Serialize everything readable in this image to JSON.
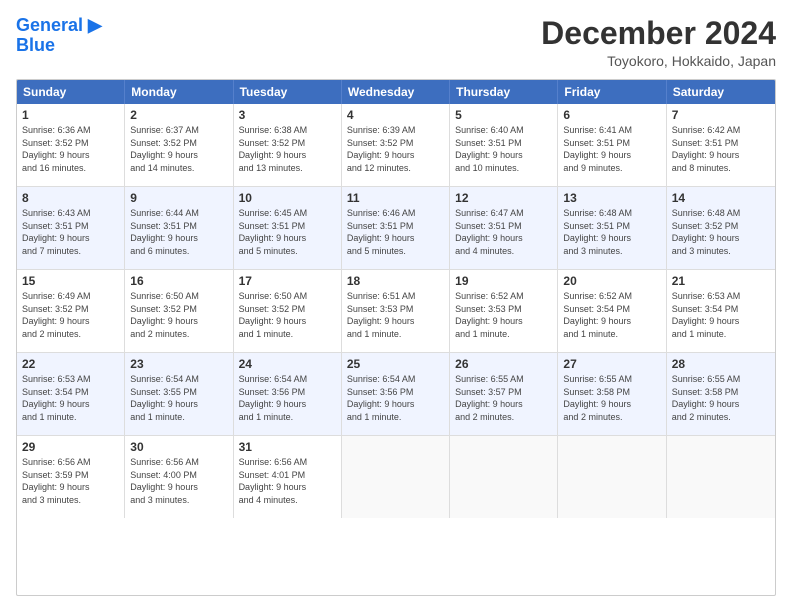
{
  "header": {
    "logo_line1": "General",
    "logo_line2": "Blue",
    "title": "December 2024",
    "subtitle": "Toyokoro, Hokkaido, Japan"
  },
  "calendar": {
    "days_of_week": [
      "Sunday",
      "Monday",
      "Tuesday",
      "Wednesday",
      "Thursday",
      "Friday",
      "Saturday"
    ],
    "rows": [
      {
        "alt": false,
        "cells": [
          {
            "day": "1",
            "info": "Sunrise: 6:36 AM\nSunset: 3:52 PM\nDaylight: 9 hours\nand 16 minutes."
          },
          {
            "day": "2",
            "info": "Sunrise: 6:37 AM\nSunset: 3:52 PM\nDaylight: 9 hours\nand 14 minutes."
          },
          {
            "day": "3",
            "info": "Sunrise: 6:38 AM\nSunset: 3:52 PM\nDaylight: 9 hours\nand 13 minutes."
          },
          {
            "day": "4",
            "info": "Sunrise: 6:39 AM\nSunset: 3:52 PM\nDaylight: 9 hours\nand 12 minutes."
          },
          {
            "day": "5",
            "info": "Sunrise: 6:40 AM\nSunset: 3:51 PM\nDaylight: 9 hours\nand 10 minutes."
          },
          {
            "day": "6",
            "info": "Sunrise: 6:41 AM\nSunset: 3:51 PM\nDaylight: 9 hours\nand 9 minutes."
          },
          {
            "day": "7",
            "info": "Sunrise: 6:42 AM\nSunset: 3:51 PM\nDaylight: 9 hours\nand 8 minutes."
          }
        ]
      },
      {
        "alt": true,
        "cells": [
          {
            "day": "8",
            "info": "Sunrise: 6:43 AM\nSunset: 3:51 PM\nDaylight: 9 hours\nand 7 minutes."
          },
          {
            "day": "9",
            "info": "Sunrise: 6:44 AM\nSunset: 3:51 PM\nDaylight: 9 hours\nand 6 minutes."
          },
          {
            "day": "10",
            "info": "Sunrise: 6:45 AM\nSunset: 3:51 PM\nDaylight: 9 hours\nand 5 minutes."
          },
          {
            "day": "11",
            "info": "Sunrise: 6:46 AM\nSunset: 3:51 PM\nDaylight: 9 hours\nand 5 minutes."
          },
          {
            "day": "12",
            "info": "Sunrise: 6:47 AM\nSunset: 3:51 PM\nDaylight: 9 hours\nand 4 minutes."
          },
          {
            "day": "13",
            "info": "Sunrise: 6:48 AM\nSunset: 3:51 PM\nDaylight: 9 hours\nand 3 minutes."
          },
          {
            "day": "14",
            "info": "Sunrise: 6:48 AM\nSunset: 3:52 PM\nDaylight: 9 hours\nand 3 minutes."
          }
        ]
      },
      {
        "alt": false,
        "cells": [
          {
            "day": "15",
            "info": "Sunrise: 6:49 AM\nSunset: 3:52 PM\nDaylight: 9 hours\nand 2 minutes."
          },
          {
            "day": "16",
            "info": "Sunrise: 6:50 AM\nSunset: 3:52 PM\nDaylight: 9 hours\nand 2 minutes."
          },
          {
            "day": "17",
            "info": "Sunrise: 6:50 AM\nSunset: 3:52 PM\nDaylight: 9 hours\nand 1 minute."
          },
          {
            "day": "18",
            "info": "Sunrise: 6:51 AM\nSunset: 3:53 PM\nDaylight: 9 hours\nand 1 minute."
          },
          {
            "day": "19",
            "info": "Sunrise: 6:52 AM\nSunset: 3:53 PM\nDaylight: 9 hours\nand 1 minute."
          },
          {
            "day": "20",
            "info": "Sunrise: 6:52 AM\nSunset: 3:54 PM\nDaylight: 9 hours\nand 1 minute."
          },
          {
            "day": "21",
            "info": "Sunrise: 6:53 AM\nSunset: 3:54 PM\nDaylight: 9 hours\nand 1 minute."
          }
        ]
      },
      {
        "alt": true,
        "cells": [
          {
            "day": "22",
            "info": "Sunrise: 6:53 AM\nSunset: 3:54 PM\nDaylight: 9 hours\nand 1 minute."
          },
          {
            "day": "23",
            "info": "Sunrise: 6:54 AM\nSunset: 3:55 PM\nDaylight: 9 hours\nand 1 minute."
          },
          {
            "day": "24",
            "info": "Sunrise: 6:54 AM\nSunset: 3:56 PM\nDaylight: 9 hours\nand 1 minute."
          },
          {
            "day": "25",
            "info": "Sunrise: 6:54 AM\nSunset: 3:56 PM\nDaylight: 9 hours\nand 1 minute."
          },
          {
            "day": "26",
            "info": "Sunrise: 6:55 AM\nSunset: 3:57 PM\nDaylight: 9 hours\nand 2 minutes."
          },
          {
            "day": "27",
            "info": "Sunrise: 6:55 AM\nSunset: 3:58 PM\nDaylight: 9 hours\nand 2 minutes."
          },
          {
            "day": "28",
            "info": "Sunrise: 6:55 AM\nSunset: 3:58 PM\nDaylight: 9 hours\nand 2 minutes."
          }
        ]
      },
      {
        "alt": false,
        "cells": [
          {
            "day": "29",
            "info": "Sunrise: 6:56 AM\nSunset: 3:59 PM\nDaylight: 9 hours\nand 3 minutes."
          },
          {
            "day": "30",
            "info": "Sunrise: 6:56 AM\nSunset: 4:00 PM\nDaylight: 9 hours\nand 3 minutes."
          },
          {
            "day": "31",
            "info": "Sunrise: 6:56 AM\nSunset: 4:01 PM\nDaylight: 9 hours\nand 4 minutes."
          },
          {
            "day": "",
            "info": ""
          },
          {
            "day": "",
            "info": ""
          },
          {
            "day": "",
            "info": ""
          },
          {
            "day": "",
            "info": ""
          }
        ]
      }
    ]
  }
}
